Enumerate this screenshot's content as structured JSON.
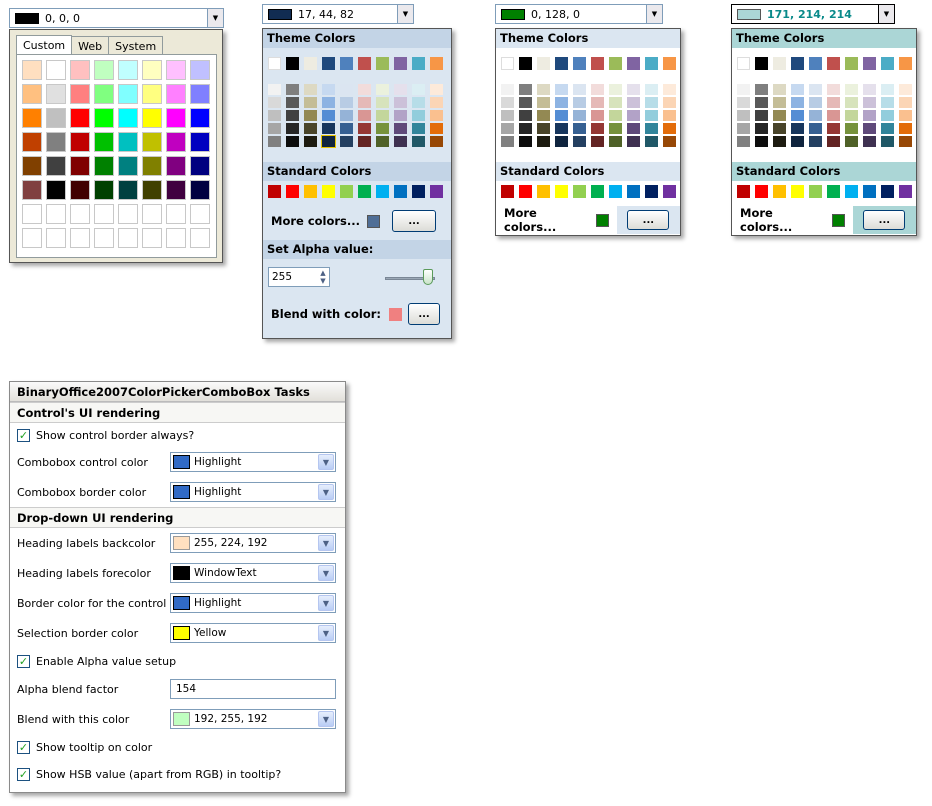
{
  "pickers": [
    {
      "value": "0, 0, 0",
      "swatch": "#000000",
      "tabs": [
        "Custom",
        "Web",
        "System"
      ]
    },
    {
      "value": "17, 44, 82",
      "swatch": "#112c52",
      "theme_heading": "Theme Colors",
      "standard_heading": "Standard Colors",
      "more_label": "More colors...",
      "more_button": "...",
      "alpha_heading": "Set Alpha value:",
      "alpha_value": "255",
      "blend_label": "Blend with color:",
      "blend_button": "..."
    },
    {
      "value": "0, 128, 0",
      "swatch": "#008000",
      "theme_heading": "Theme Colors",
      "standard_heading": "Standard Colors",
      "more_label": "More colors...",
      "more_button": "..."
    },
    {
      "value": "171, 214, 214",
      "swatch": "#abd6d6",
      "theme_heading": "Theme Colors",
      "standard_heading": "Standard Colors",
      "more_label": "More colors...",
      "more_button": "..."
    }
  ],
  "custom_colors": [
    "#ffdfc0",
    "#ffffff",
    "#ffc0c0",
    "#c0ffc0",
    "#c0ffff",
    "#ffffc0",
    "#ffc0ff",
    "#c0c0ff",
    "#ffc080",
    "#e0e0e0",
    "#ff8080",
    "#80ff80",
    "#80ffff",
    "#ffff80",
    "#ff80ff",
    "#8080ff",
    "#ff8000",
    "#c0c0c0",
    "#ff0000",
    "#00ff00",
    "#00ffff",
    "#ffff00",
    "#ff00ff",
    "#0000ff",
    "#c04000",
    "#808080",
    "#c00000",
    "#00c000",
    "#00c0c0",
    "#c0c000",
    "#c000c0",
    "#0000c0",
    "#804000",
    "#404040",
    "#800000",
    "#008000",
    "#008080",
    "#808000",
    "#800080",
    "#000080",
    "#804040",
    "#000000",
    "#400000",
    "#004000",
    "#004040",
    "#404000",
    "#400040",
    "#000040",
    "#ffffff",
    "#ffffff",
    "#ffffff",
    "#ffffff",
    "#ffffff",
    "#ffffff",
    "#ffffff",
    "#ffffff",
    "#ffffff",
    "#ffffff",
    "#ffffff",
    "#ffffff",
    "#ffffff",
    "#ffffff",
    "#ffffff",
    "#ffffff"
  ],
  "theme_top": [
    "#ffffff",
    "#000000",
    "#eeece1",
    "#1f497d",
    "#4f81bd",
    "#c0504d",
    "#9bbb59",
    "#8064a2",
    "#4bacc6",
    "#f79646"
  ],
  "theme_shades": [
    [
      "#f2f2f2",
      "#d9d9d9",
      "#bfbfbf",
      "#a6a6a6",
      "#808080"
    ],
    [
      "#7f7f7f",
      "#595959",
      "#404040",
      "#262626",
      "#0d0d0d"
    ],
    [
      "#ddd9c3",
      "#c4bd97",
      "#938953",
      "#494429",
      "#1d1b10"
    ],
    [
      "#c6d9f0",
      "#8db3e2",
      "#548dd4",
      "#17365d",
      "#0f243e"
    ],
    [
      "#dbe5f1",
      "#b8cce4",
      "#95b3d7",
      "#366092",
      "#244061"
    ],
    [
      "#f2dcdb",
      "#e5b9b7",
      "#d99694",
      "#953734",
      "#632423"
    ],
    [
      "#ebf1dd",
      "#d7e3bc",
      "#c3d69b",
      "#76923c",
      "#4f6128"
    ],
    [
      "#e5e0ec",
      "#ccc1d9",
      "#b2a2c7",
      "#5f497a",
      "#3f3151"
    ],
    [
      "#dbeef3",
      "#b7dde8",
      "#92cddc",
      "#31859b",
      "#205867"
    ],
    [
      "#fdeada",
      "#fbd5b5",
      "#fac08f",
      "#e36c09",
      "#974806"
    ]
  ],
  "standard_colors": [
    "#c00000",
    "#ff0000",
    "#ffc000",
    "#ffff00",
    "#92d050",
    "#00b050",
    "#00b0f0",
    "#0070c0",
    "#002060",
    "#7030a0"
  ],
  "more_swatches": [
    "#4f6e96",
    "#008000",
    "#008000"
  ],
  "blend_swatch": "#f08080",
  "tasks": {
    "title": "BinaryOffice2007ColorPickerComboBox Tasks",
    "sec1": "Control's UI rendering",
    "show_border": "Show control border always?",
    "combo_color_label": "Combobox control color",
    "combo_color_value": "Highlight",
    "combo_color_swatch": "#316ac5",
    "combo_border_label": "Combobox border color",
    "combo_border_value": "Highlight",
    "combo_border_swatch": "#316ac5",
    "sec2": "Drop-down UI rendering",
    "head_back_label": "Heading labels backcolor",
    "head_back_value": "255, 224, 192",
    "head_back_swatch": "#ffe0c0",
    "head_fore_label": "Heading labels forecolor",
    "head_fore_value": "WindowText",
    "head_fore_swatch": "#000000",
    "border_ctrl_label": "Border color for the control",
    "border_ctrl_value": "Highlight",
    "border_ctrl_swatch": "#316ac5",
    "sel_border_label": "Selection border color",
    "sel_border_value": "Yellow",
    "sel_border_swatch": "#ffff00",
    "enable_alpha": "Enable Alpha value setup",
    "alpha_factor_label": "Alpha blend factor",
    "alpha_factor_value": "154",
    "blend_label": "Blend with this color",
    "blend_value": "192, 255, 192",
    "blend_swatch": "#c0ffc0",
    "tooltip": "Show tooltip on color",
    "hsb": "Show HSB value (apart from RGB) in tooltip?"
  }
}
